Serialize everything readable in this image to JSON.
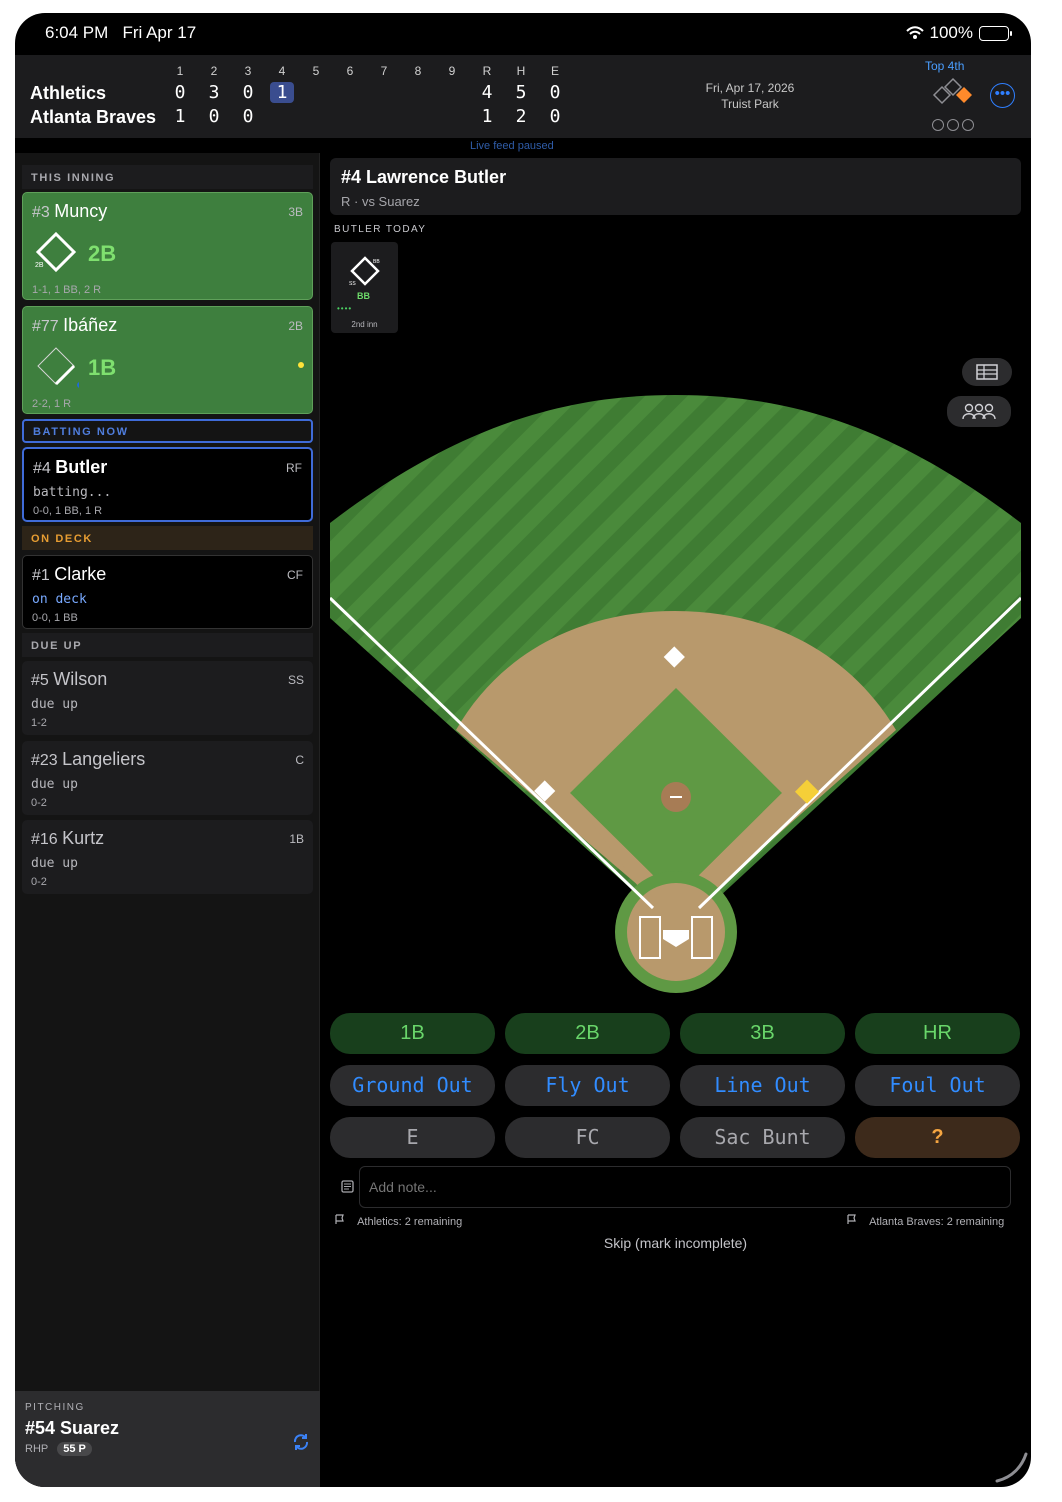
{
  "status_bar": {
    "time": "6:04 PM",
    "date": "Fri Apr 17",
    "battery": "100%"
  },
  "scoreboard": {
    "innings": [
      "1",
      "2",
      "3",
      "4",
      "5",
      "6",
      "7",
      "8",
      "9"
    ],
    "totals_headers": [
      "R",
      "H",
      "E"
    ],
    "teams": [
      {
        "name": "Athletics",
        "scores": [
          "0",
          "3",
          "0",
          "1"
        ],
        "totals": [
          "4",
          "5",
          "0"
        ]
      },
      {
        "name": "Atlanta Braves",
        "scores": [
          "1",
          "0",
          "0"
        ],
        "totals": [
          "1",
          "2",
          "0"
        ]
      }
    ],
    "current_inning_index": 3
  },
  "game_info": {
    "date": "Fri, Apr 17, 2026",
    "venue": "Truist Park",
    "inning": "Top 4th"
  },
  "live_feed": "Live feed paused",
  "sidebar": {
    "this_inning": "THIS INNING",
    "batting_now": "BATTING NOW",
    "on_deck": "ON DECK",
    "due_up": "DUE UP",
    "inning_batters": [
      {
        "num": "#3",
        "name": "Muncy",
        "pos": "3B",
        "result": "2B",
        "base_label": "2B",
        "line": "1-1, 1 BB, 2 R"
      },
      {
        "num": "#77",
        "name": "Ibáñez",
        "pos": "2B",
        "result": "1B",
        "line": "2-2, 1 R"
      }
    ],
    "current": {
      "num": "#4",
      "name": "Butler",
      "pos": "RF",
      "note": "batting...",
      "line": "0-0, 1 BB, 1 R"
    },
    "deck": {
      "num": "#1",
      "name": "Clarke",
      "pos": "CF",
      "note": "on deck",
      "line": "0-0, 1 BB"
    },
    "due": [
      {
        "num": "#5",
        "name": "Wilson",
        "pos": "SS",
        "note": "due up",
        "line": "1-2"
      },
      {
        "num": "#23",
        "name": "Langeliers",
        "pos": "C",
        "note": "due up",
        "line": "0-2"
      },
      {
        "num": "#16",
        "name": "Kurtz",
        "pos": "1B",
        "note": "due up",
        "line": "0-2"
      }
    ]
  },
  "pitching": {
    "label": "PITCHING",
    "name": "#54 Suarez",
    "hand": "RHP",
    "pitch_count": "55 P"
  },
  "batter": {
    "title": "#4 Lawrence Butler",
    "subtitle": "R · vs Suarez"
  },
  "today": {
    "label": "BUTLER TODAY",
    "position": "SS",
    "base_tag": "BB",
    "result": "BB",
    "inning": "2nd inn"
  },
  "actions": {
    "hits": [
      "1B",
      "2B",
      "3B",
      "HR"
    ],
    "outs": [
      "Ground Out",
      "Fly Out",
      "Line Out",
      "Foul Out"
    ],
    "other": [
      "E",
      "FC",
      "Sac Bunt",
      "?"
    ]
  },
  "note": {
    "placeholder": "Add note..."
  },
  "remaining": {
    "athletics": "Athletics: 2 remaining",
    "braves": "Atlanta Braves: 2 remaining"
  },
  "skip": "Skip (mark incomplete)",
  "colors": {
    "accent": "#2f7fff",
    "hit": "#69d66a",
    "warning": "#f5a541",
    "field_grass": "#4f8f3f",
    "infield_dirt": "#b8996c"
  },
  "icons": [
    "wifi-icon",
    "battery-icon",
    "more-icon",
    "table-icon",
    "team-icon",
    "note-icon",
    "flag-icon",
    "sync-icon"
  ]
}
